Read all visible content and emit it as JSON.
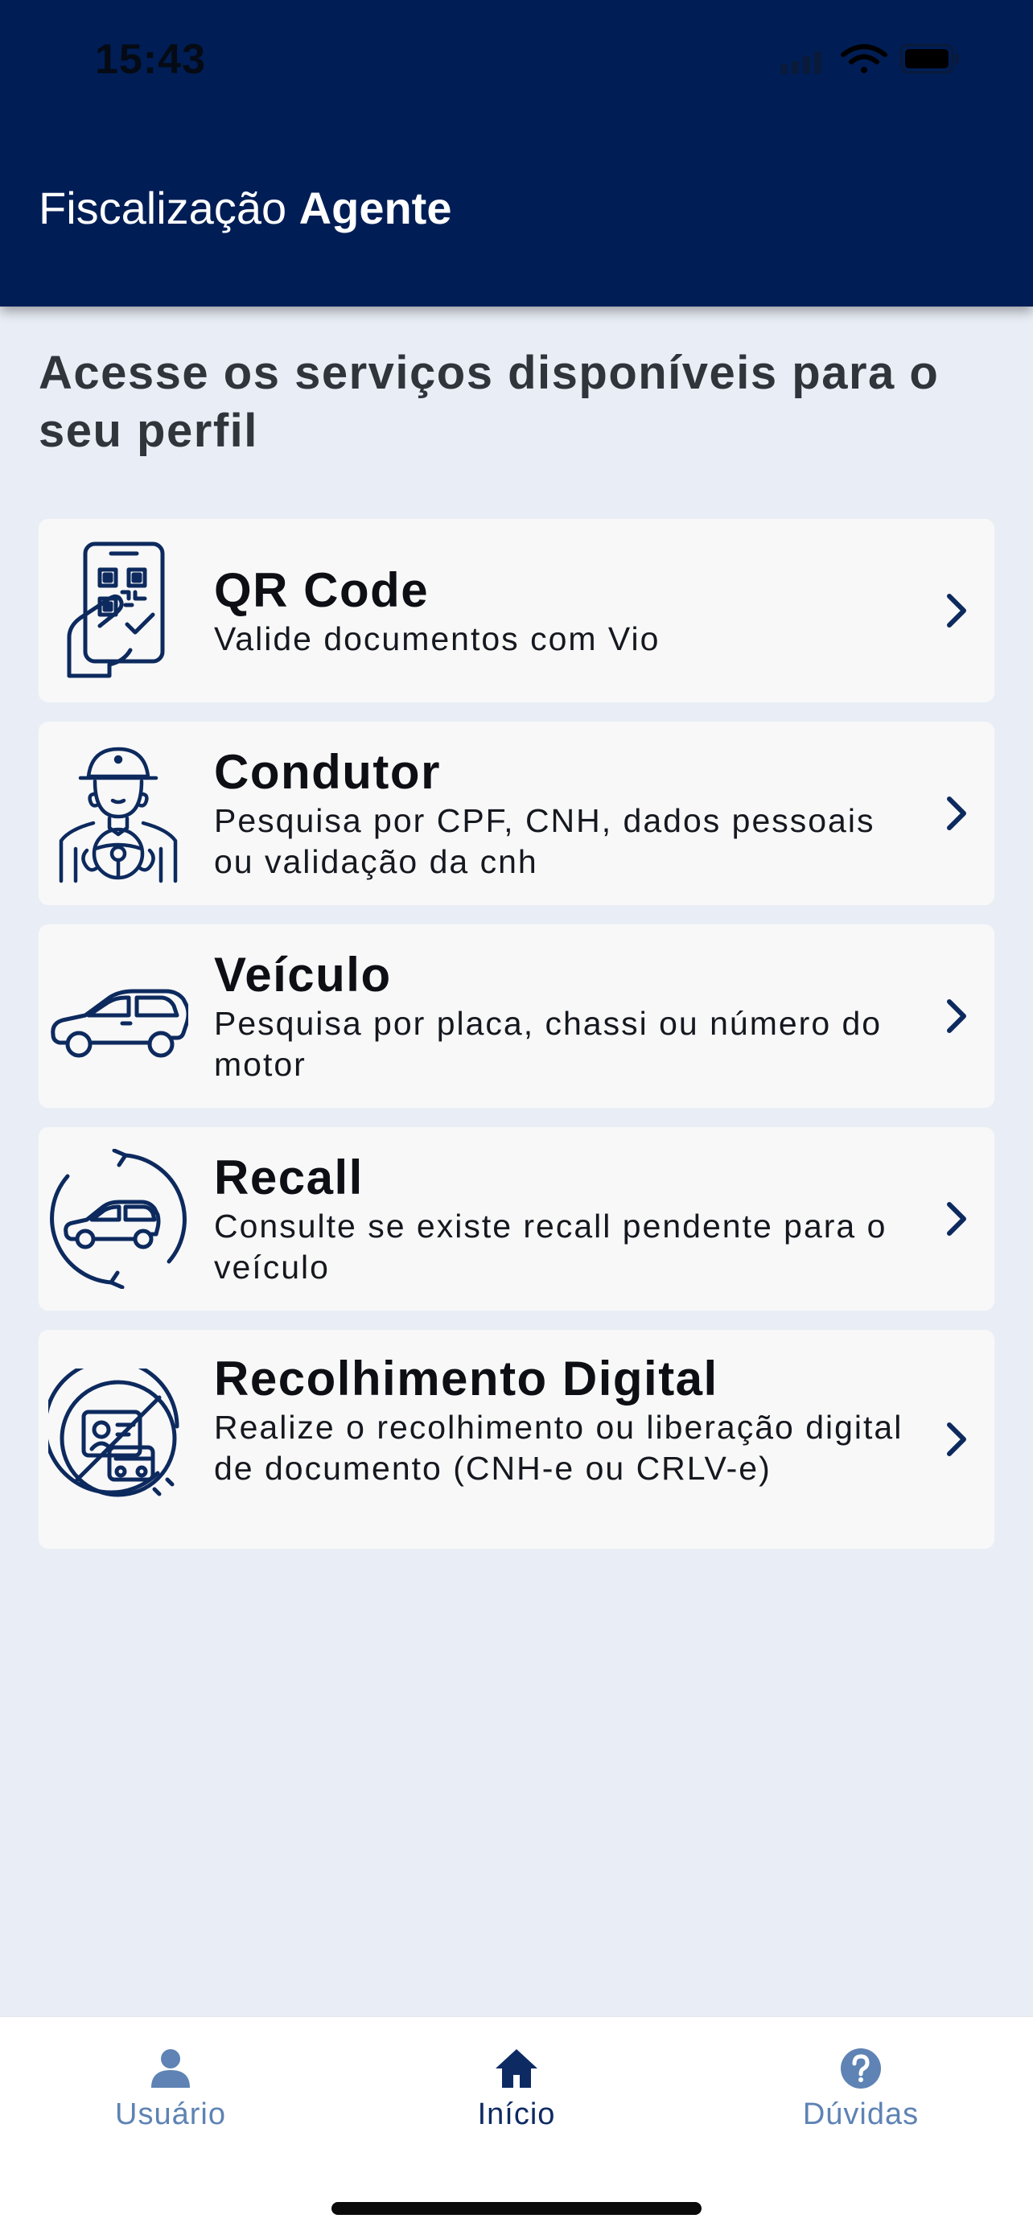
{
  "status_bar": {
    "time": "15:43"
  },
  "header": {
    "title_regular": "Fiscalização",
    "title_bold": "Agente"
  },
  "intro": "Acesse os serviços disponíveis para o seu perfil",
  "services": [
    {
      "title": "QR Code",
      "subtitle": "Valide documentos com Vio",
      "icon": "qr-code-phone-icon"
    },
    {
      "title": "Condutor",
      "subtitle": "Pesquisa por CPF, CNH, dados pessoais ou validação da cnh",
      "icon": "driver-icon"
    },
    {
      "title": "Veículo",
      "subtitle": "Pesquisa por placa, chassi ou número do motor",
      "icon": "car-icon"
    },
    {
      "title": "Recall",
      "subtitle": "Consulte se existe recall pendente para o veículo",
      "icon": "recall-car-icon"
    },
    {
      "title": "Recolhimento Digital",
      "subtitle": "Realize o recolhimento ou liberação digital de documento (CNH-e ou CRLV-e)",
      "icon": "digital-collection-icon"
    }
  ],
  "tabs": [
    {
      "label": "Usuário",
      "icon": "user-icon",
      "active": false
    },
    {
      "label": "Início",
      "icon": "home-icon",
      "active": true
    },
    {
      "label": "Dúvidas",
      "icon": "help-icon",
      "active": false
    }
  ],
  "colors": {
    "header": "#001e55",
    "background": "#e9eef6",
    "icon": "#0d2a5e",
    "tab_inactive": "#5e83b4",
    "tab_active": "#0e2a63"
  }
}
